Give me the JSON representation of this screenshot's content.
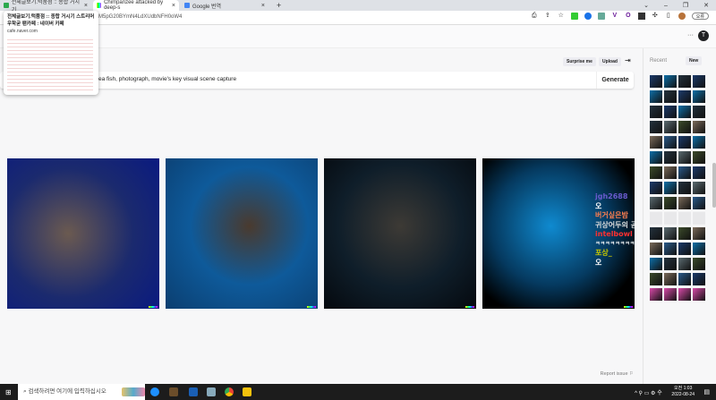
{
  "browser": {
    "tabs": [
      {
        "title": "전체글보기.턱품점 :: 종합 거시기",
        "color": "#2da94f",
        "active": false
      },
      {
        "title": "Chimpanzee attacked by deep-s",
        "color": "#9b59b6",
        "active": true
      },
      {
        "title": "Google 번역",
        "color": "#4285f4",
        "active": false
      }
    ],
    "new_tab": "+",
    "url": "M5pG20BYmN4LdXUdbNFH0oW4",
    "profile_label": "오류",
    "tooltip": {
      "title": "전체글보기.턱품점 :: 종합 거시기 스트리머 우학굳 팬카페 : 네이버 카페",
      "url": "cafe.naver.com"
    }
  },
  "app": {
    "avatar_letter": "T",
    "more": "···",
    "surprise_label": "Surprise me",
    "upload_label": "Upload",
    "prompt_text": "ea fish, photograph, movie's key visual scene capture",
    "generate_label": "Generate",
    "report_label": "Report issue",
    "sidebar": {
      "title": "Recent",
      "new_label": "New"
    }
  },
  "chat_overlay": [
    {
      "user": "jgh2688",
      "msg": "오",
      "color": "#6a5acd"
    },
    {
      "user": "버거싶은밤",
      "msg": "귀상어두의 공격",
      "color": "#ff7f50"
    },
    {
      "user": "intelbowl",
      "msg": "ㅋㅋㅋㅋㅋㅋㅋㅋ",
      "color": "#ff3030"
    },
    {
      "user": "포상_",
      "msg": "오",
      "color": "#c8c800"
    }
  ],
  "taskbar": {
    "search_placeholder": "검색하려면 여기에 입력하십시오",
    "time": "오전 1:03",
    "date": "2022-08-24"
  }
}
